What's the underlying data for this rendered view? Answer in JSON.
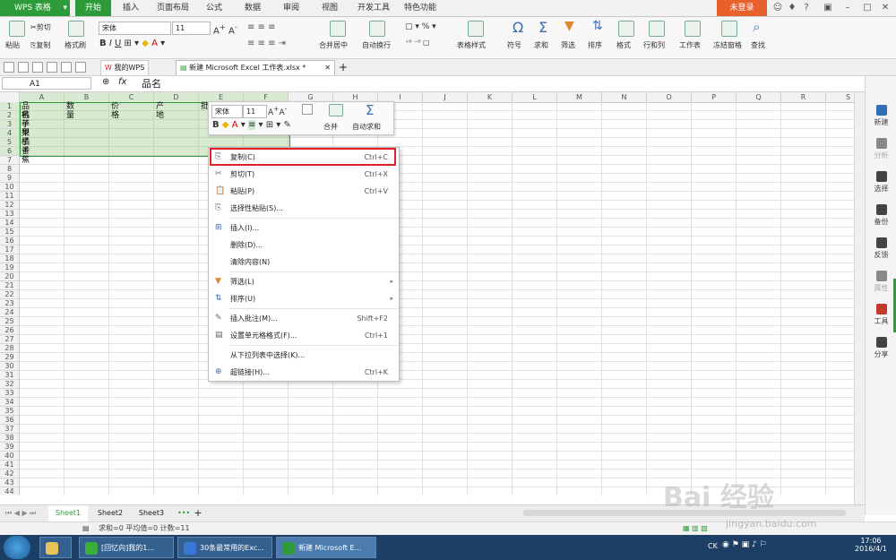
{
  "app": {
    "logo": "WPS 表格",
    "login": "未登录"
  },
  "ribbon_tabs": [
    "开始",
    "插入",
    "页面布局",
    "公式",
    "数据",
    "审阅",
    "视图",
    "开发工具",
    "特色功能"
  ],
  "ribbon": {
    "paste": "粘贴",
    "cut": "剪切",
    "copy": "复制",
    "format_painter": "格式刷",
    "font": "宋体",
    "size": "11",
    "merge_center": "合并居中",
    "wrap": "自动换行",
    "percent": "%",
    "table_style": "表格样式",
    "symbol": "符号",
    "sum": "求和",
    "filter": "筛选",
    "sort": "排序",
    "format": "格式",
    "row_col": "行和列",
    "worksheet": "工作表",
    "freeze": "冻结窗格",
    "find": "查找"
  },
  "doc_tabs": [
    "我的WPS",
    "新建 Microsoft Excel 工作表.xlsx *"
  ],
  "formula_bar": {
    "name_box": "A1",
    "fx": "fx",
    "content": "品名"
  },
  "columns": [
    "A",
    "B",
    "C",
    "D",
    "E",
    "F",
    "G",
    "H",
    "I",
    "J",
    "K",
    "L",
    "M",
    "N",
    "O",
    "P",
    "Q",
    "R",
    "S"
  ],
  "rows": [
    "1",
    "2",
    "3",
    "4",
    "5",
    "6",
    "7",
    "8",
    "9",
    "10",
    "11",
    "12",
    "13",
    "14",
    "15",
    "16",
    "17",
    "18",
    "19",
    "20",
    "21",
    "22",
    "23",
    "24",
    "25",
    "26",
    "27",
    "28",
    "29",
    "30",
    "31",
    "32",
    "33",
    "34",
    "35",
    "36",
    "37",
    "38",
    "39",
    "40",
    "41",
    "42",
    "43",
    "44"
  ],
  "cells": {
    "header": [
      "品名",
      "数量",
      "价格",
      "产地",
      "批"
    ],
    "items": [
      "桃子",
      "苹果",
      "梨子",
      "橘子",
      "香蕉"
    ]
  },
  "mini_toolbar": {
    "font": "宋体",
    "size": "11",
    "bold": "B",
    "merge": "合并",
    "autosum": "自动求和"
  },
  "context_menu": [
    {
      "label": "复制(C)",
      "shortcut": "Ctrl+C",
      "icon": "copy-icon"
    },
    {
      "label": "剪切(T)",
      "shortcut": "Ctrl+X",
      "icon": "scissors-icon"
    },
    {
      "label": "粘贴(P)",
      "shortcut": "Ctrl+V",
      "icon": "paste-icon"
    },
    {
      "label": "选择性粘贴(S)...",
      "shortcut": "",
      "icon": "paste-special-icon"
    },
    {
      "label": "插入(I)...",
      "shortcut": "",
      "icon": "insert-icon"
    },
    {
      "label": "删除(D)...",
      "shortcut": "",
      "icon": ""
    },
    {
      "label": "清除内容(N)",
      "shortcut": "",
      "icon": ""
    },
    {
      "label": "筛选(L)",
      "shortcut": "",
      "icon": "filter-icon",
      "submenu": true
    },
    {
      "label": "排序(U)",
      "shortcut": "",
      "icon": "sort-icon",
      "submenu": true
    },
    {
      "label": "插入批注(M)...",
      "shortcut": "Shift+F2",
      "icon": "comment-icon"
    },
    {
      "label": "设置单元格格式(F)...",
      "shortcut": "Ctrl+1",
      "icon": "format-cells-icon"
    },
    {
      "label": "从下拉列表中选择(K)...",
      "shortcut": "",
      "icon": ""
    },
    {
      "label": "超链接(H)...",
      "shortcut": "Ctrl+K",
      "icon": "hyperlink-icon"
    }
  ],
  "right_panel": [
    "新建",
    "分析",
    "选择",
    "备份",
    "反馈",
    "属性",
    "工具",
    "分享"
  ],
  "sheets": [
    "Sheet1",
    "Sheet2",
    "Sheet3"
  ],
  "status": "求和=0  平均值=0  计数=11",
  "taskbar": {
    "items": [
      "[回忆向]我的1...",
      "30条最常用的Exc...",
      "新建 Microsoft E..."
    ],
    "tray_lang": "CK",
    "time": "17:06",
    "date": "2016/4/1"
  },
  "watermark": "Bai 经验",
  "watermark_url": "jingyan.baidu.com"
}
